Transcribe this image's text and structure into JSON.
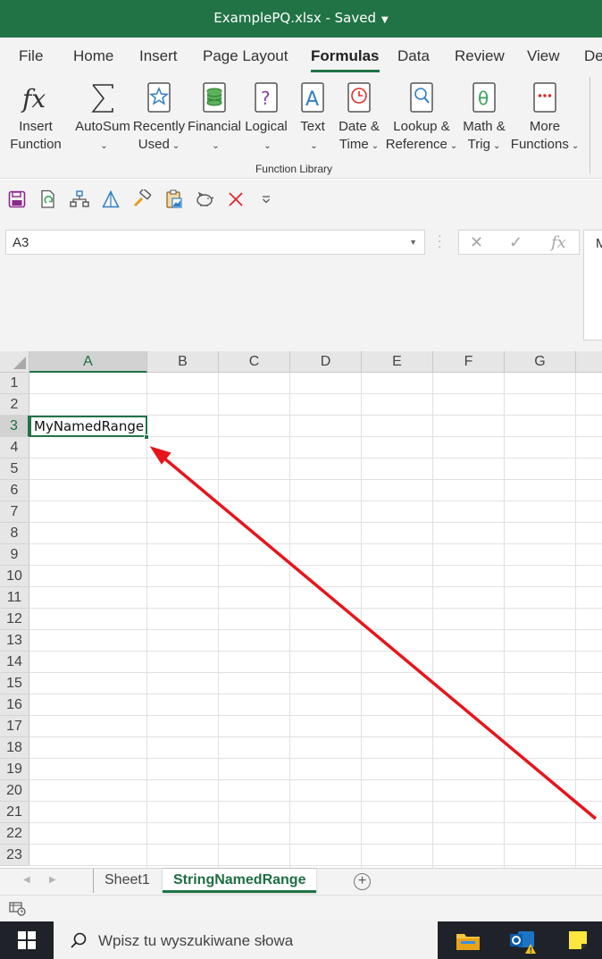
{
  "window": {
    "title": "ExamplePQ.xlsx  -  Saved"
  },
  "ribbon_tabs": [
    "File",
    "Home",
    "Insert",
    "Page Layout",
    "Formulas",
    "Data",
    "Review",
    "View",
    "De"
  ],
  "active_tab": "Formulas",
  "function_library": {
    "group_label": "Function Library",
    "buttons": [
      {
        "line1": "Insert",
        "line2": "Function",
        "icon": "fx-icon"
      },
      {
        "line1": "AutoSum",
        "line2": "",
        "icon": "sigma-icon"
      },
      {
        "line1": "Recently",
        "line2": "Used",
        "icon": "star-book-icon"
      },
      {
        "line1": "Financial",
        "line2": "",
        "icon": "coins-book-icon"
      },
      {
        "line1": "Logical",
        "line2": "",
        "icon": "question-book-icon"
      },
      {
        "line1": "Text",
        "line2": "",
        "icon": "text-book-icon"
      },
      {
        "line1": "Date &",
        "line2": "Time",
        "icon": "clock-book-icon"
      },
      {
        "line1": "Lookup &",
        "line2": "Reference",
        "icon": "magnifier-book-icon"
      },
      {
        "line1": "Math &",
        "line2": "Trig",
        "icon": "theta-book-icon"
      },
      {
        "line1": "More",
        "line2": "Functions",
        "icon": "dots-book-icon"
      }
    ]
  },
  "quick_access": [
    "save-icon",
    "refresh-file-icon",
    "hierarchy-icon",
    "triangle-icon",
    "format-painter-icon",
    "paste-picture-icon",
    "piggy-bank-icon",
    "delete-x-icon",
    "customize-dropdown-icon"
  ],
  "formula_bar": {
    "name_box": "A3",
    "content_preview": "M"
  },
  "grid": {
    "columns": [
      "A",
      "B",
      "C",
      "D",
      "E",
      "F",
      "G"
    ],
    "rows": [
      "1",
      "2",
      "3",
      "4",
      "5",
      "6",
      "7",
      "8",
      "9",
      "10",
      "11",
      "12",
      "13",
      "14",
      "15",
      "16",
      "17",
      "18",
      "19",
      "20",
      "21",
      "22",
      "23"
    ],
    "active_cell": {
      "ref": "A3",
      "value": "MyNamedRange"
    }
  },
  "sheets": {
    "tabs": [
      "Sheet1",
      "StringNamedRange"
    ],
    "active": "StringNamedRange"
  },
  "taskbar": {
    "search_placeholder": "Wpisz tu wyszukiwane słowa"
  },
  "colors": {
    "excel_green": "#217346",
    "arrow_red": "#e8141b"
  }
}
